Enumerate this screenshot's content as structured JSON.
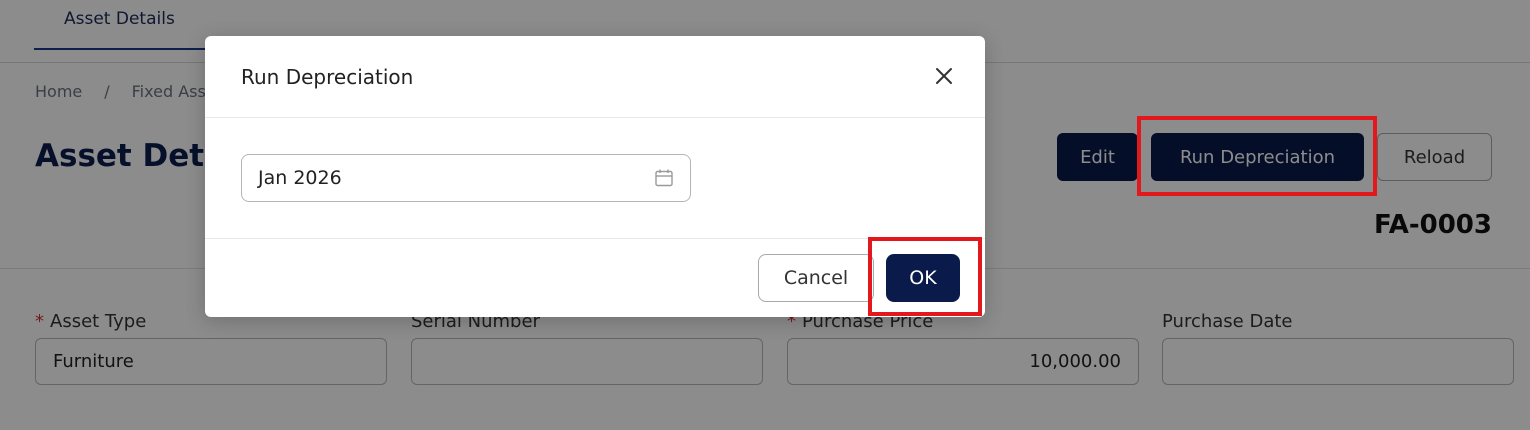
{
  "tabs": [
    {
      "label": "Asset Details"
    }
  ],
  "breadcrumb": {
    "home": "Home",
    "current": "Fixed Asse",
    "separator": "/"
  },
  "page_title": "Asset Deta",
  "actions": {
    "edit": "Edit",
    "run_depreciation": "Run Depreciation",
    "reload": "Reload"
  },
  "asset_code": "FA-0003",
  "fields": [
    {
      "label": "Asset Type",
      "required": true,
      "value": "Furniture"
    },
    {
      "label": "Serial Number",
      "required": false,
      "value": ""
    },
    {
      "label": "Purchase Price",
      "required": true,
      "value": "10,000.00"
    },
    {
      "label": "Purchase Date",
      "required": false,
      "value": ""
    }
  ],
  "modal": {
    "title": "Run Depreciation",
    "period_value": "Jan 2026",
    "cancel_label": "Cancel",
    "ok_label": "OK"
  },
  "colors": {
    "primary": "#0a1a4a",
    "highlight": "#e3181c",
    "required": "#d32f2f"
  }
}
